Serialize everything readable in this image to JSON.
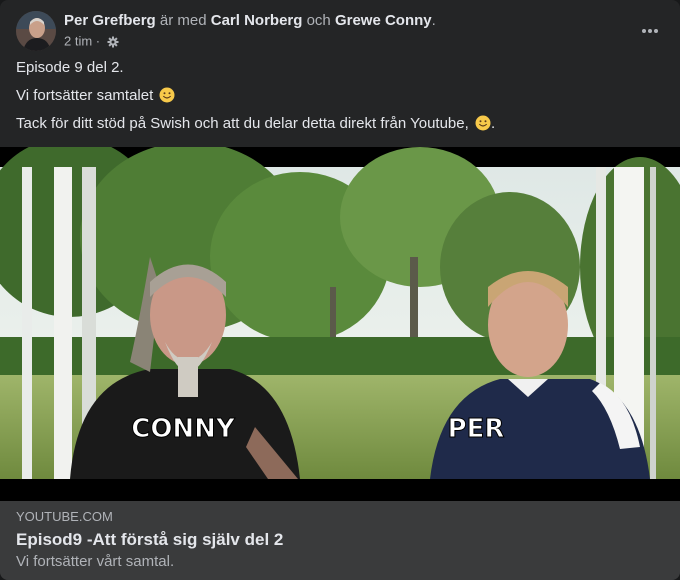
{
  "post": {
    "author": "Per Grefberg",
    "with_text": "är med",
    "tagged_1": "Carl Norberg",
    "and_text": "och",
    "tagged_2": "Grewe Conny",
    "end_punct": ".",
    "time": "2 tim",
    "separator": "·",
    "privacy_icon": "gear-icon",
    "more_icon": "more-options-icon",
    "lines": [
      {
        "text": "Episode 9 del 2."
      },
      {
        "text": "Vi fortsätter samtalet",
        "emoji": "slightly-smiling-face"
      },
      {
        "text": "Tack för ditt stöd på Swish och att du delar detta direkt från Youtube,",
        "emoji": "slightly-smiling-face",
        "after": "."
      }
    ]
  },
  "video": {
    "captions": [
      "CONNY",
      "PER"
    ]
  },
  "link": {
    "domain": "YOUTUBE.COM",
    "title": "Episod9 -Att förstå sig själv del 2",
    "description": "Vi fortsätter vårt samtal."
  },
  "colors": {
    "card": "#242526",
    "link_card": "#3a3b3c",
    "primary_text": "#e4e6eb",
    "secondary_text": "#b0b3b8"
  }
}
